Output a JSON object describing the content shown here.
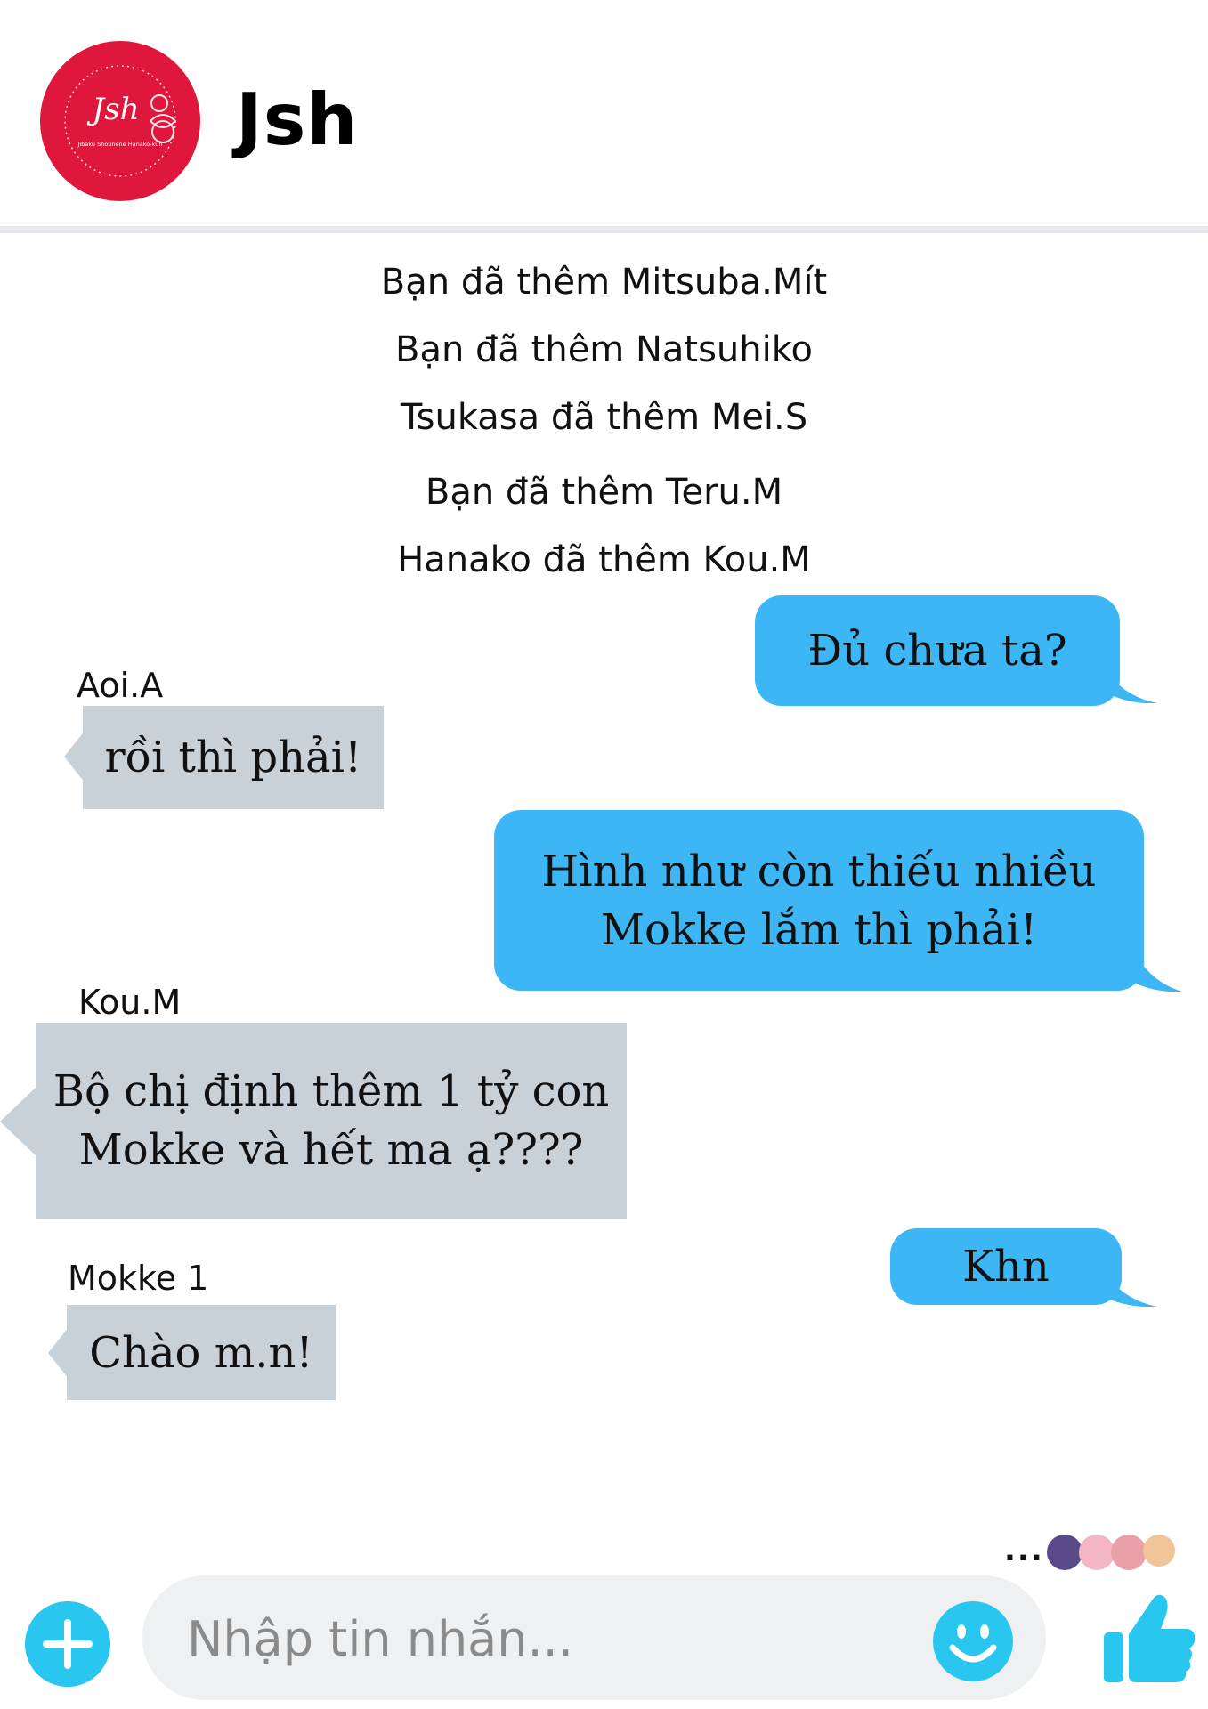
{
  "header": {
    "group_name": "Jsh",
    "avatar_logo_text": "Jsh",
    "avatar_logo_subtitle": "Jibaku Shounene Hanako-kun"
  },
  "system_messages": [
    "Bạn đã thêm Mitsuba.Mít",
    "Bạn đã thêm Natsuhiko",
    "Tsukasa đã thêm Mei.S",
    "Bạn đã thêm Teru.M",
    "Hanako đã thêm Kou.M"
  ],
  "messages": [
    {
      "direction": "outgoing",
      "lines": [
        "Đủ chưa ta?"
      ]
    },
    {
      "direction": "incoming",
      "sender": "Aoi.A",
      "lines": [
        "rồi thì phải!"
      ]
    },
    {
      "direction": "outgoing",
      "lines": [
        "Hình như còn thiếu nhiều",
        "Mokke lắm thì phải!"
      ]
    },
    {
      "direction": "incoming",
      "sender": "Kou.M",
      "lines": [
        "Bộ chị định thêm 1 tỷ con",
        "Mokke và hết ma ạ????"
      ]
    },
    {
      "direction": "outgoing",
      "lines": [
        "Khn"
      ]
    },
    {
      "direction": "incoming",
      "sender": "Mokke 1",
      "lines": [
        "Chào m.n!"
      ]
    }
  ],
  "typing": {
    "dots": "..."
  },
  "composer": {
    "placeholder": "Nhập tin nhắn...",
    "add_icon": "plus-circle-icon",
    "emoji_icon": "smiley-icon",
    "like_icon": "thumbs-up-icon"
  },
  "colors": {
    "outgoing_bubble": "#3cb6f5",
    "incoming_bubble": "#c8d0d8",
    "avatar": "#e0173c",
    "accent_icon": "#29c6ef"
  }
}
